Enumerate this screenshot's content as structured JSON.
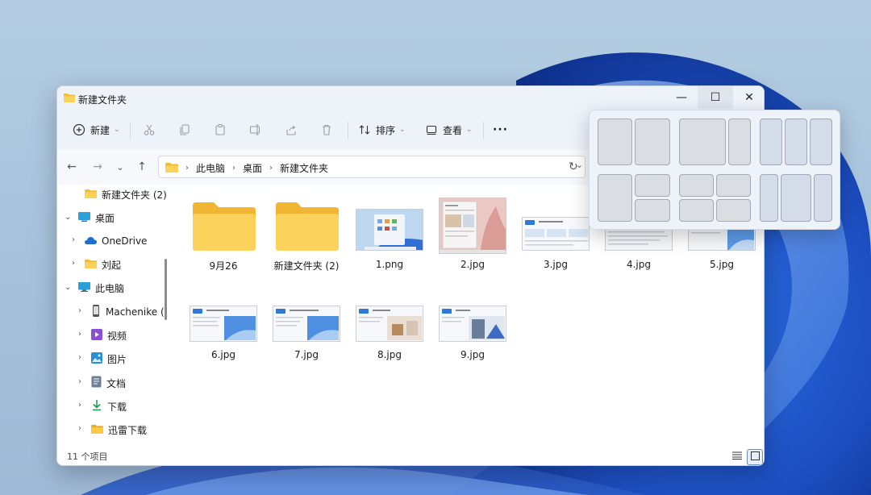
{
  "window": {
    "title": "新建文件夹",
    "controls": {
      "minimize": "—",
      "maximize": "☐",
      "close": "✕"
    }
  },
  "toolbar": {
    "new_label": "新建",
    "sort_label": "排序",
    "view_label": "查看",
    "more_label": "···",
    "icons": [
      "new-icon",
      "cut-icon",
      "copy-icon",
      "paste-icon",
      "rename-icon",
      "share-icon",
      "delete-icon",
      "sort-icon",
      "view-icon",
      "more-icon"
    ]
  },
  "address": {
    "crumbs": [
      "此电脑",
      "桌面",
      "新建文件夹"
    ],
    "back": "←",
    "forward": "→",
    "recent": "⌄",
    "up": "↑",
    "dropdown": "⌄",
    "refresh": "↻"
  },
  "nav_pane": {
    "items": [
      {
        "label": "新建文件夹 (2)",
        "icon": "folder-icon"
      },
      {
        "label": "桌面",
        "icon": "desktop-icon",
        "expanded": true
      },
      {
        "label": "OneDrive",
        "icon": "cloud-icon"
      },
      {
        "label": "刘起",
        "icon": "folder-icon"
      },
      {
        "label": "此电脑",
        "icon": "pc-icon",
        "expanded": true
      },
      {
        "label": "Machenike (",
        "icon": "phone-icon"
      },
      {
        "label": "视频",
        "icon": "video-icon"
      },
      {
        "label": "图片",
        "icon": "picture-icon"
      },
      {
        "label": "文档",
        "icon": "document-icon"
      },
      {
        "label": "下载",
        "icon": "download-icon"
      },
      {
        "label": "迅雷下载",
        "icon": "folder-icon"
      }
    ]
  },
  "files": [
    {
      "name": "9月26",
      "type": "folder"
    },
    {
      "name": "新建文件夹 (2)",
      "type": "folder"
    },
    {
      "name": "1.png",
      "type": "image"
    },
    {
      "name": "2.jpg",
      "type": "image"
    },
    {
      "name": "3.jpg",
      "type": "image"
    },
    {
      "name": "4.jpg",
      "type": "image"
    },
    {
      "name": "5.jpg",
      "type": "image"
    },
    {
      "name": "6.jpg",
      "type": "image"
    },
    {
      "name": "7.jpg",
      "type": "image"
    },
    {
      "name": "8.jpg",
      "type": "image"
    },
    {
      "name": "9.jpg",
      "type": "image"
    }
  ],
  "status": {
    "count": "11 个项目"
  },
  "colors": {
    "accent": "#0067c0",
    "folder": "#f7c948",
    "window_bg": "#eef2f9"
  }
}
